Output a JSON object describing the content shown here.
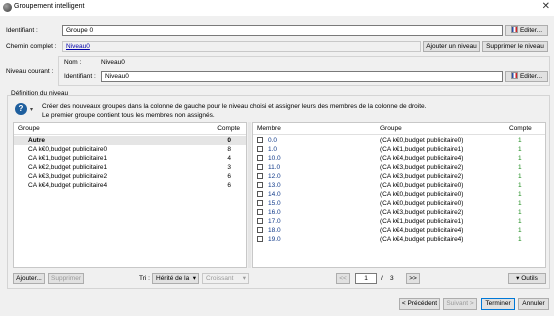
{
  "window": {
    "title": "Groupement intelligent",
    "close": "✕"
  },
  "form": {
    "identifiant_label": "Identifiant :",
    "identifiant_value": "Groupe 0",
    "edit_label": "Editer...",
    "chemin_label": "Chemin complet :",
    "chemin_value": "Niveau0",
    "add_level": "Ajouter un niveau",
    "remove_level": "Supprimer le niveau",
    "niveau_courant_label": "Niveau courant :",
    "nom_label": "Nom :",
    "nom_value": "Niveau0",
    "identifiant2_label": "Identifiant :",
    "identifiant2_value": "Niveau0",
    "definition_label": "Définition du niveau",
    "info_line1": "Créer des nouveaux groupes dans la colonne de gauche pour le niveau choisi et assigner leurs des membres de la colonne de droite.",
    "info_line2": "Le premier groupe contient tous les membres non assignés."
  },
  "left_table": {
    "col_group": "Groupe",
    "col_count": "Compte",
    "rows": [
      {
        "name": "Autre",
        "count": "0"
      },
      {
        "name": "CA k€0,budget publicitaire0",
        "count": "8"
      },
      {
        "name": "CA k€1,budget publicitaire1",
        "count": "4"
      },
      {
        "name": "CA k€2,budget publicitaire1",
        "count": "3"
      },
      {
        "name": "CA k€3,budget publicitaire2",
        "count": "6"
      },
      {
        "name": "CA k€4,budget publicitaire4",
        "count": "6"
      }
    ]
  },
  "right_table": {
    "col_member": "Membre",
    "col_group": "Groupe",
    "col_count": "Compte",
    "rows": [
      {
        "member": "0.0",
        "group": "(CA k€0,budget publicitaire0)",
        "count": "1"
      },
      {
        "member": "1.0",
        "group": "(CA k€1,budget publicitaire1)",
        "count": "1"
      },
      {
        "member": "10.0",
        "group": "(CA k€4,budget publicitaire4)",
        "count": "1"
      },
      {
        "member": "11.0",
        "group": "(CA k€3,budget publicitaire2)",
        "count": "1"
      },
      {
        "member": "12.0",
        "group": "(CA k€3,budget publicitaire2)",
        "count": "1"
      },
      {
        "member": "13.0",
        "group": "(CA k€0,budget publicitaire0)",
        "count": "1"
      },
      {
        "member": "14.0",
        "group": "(CA k€0,budget publicitaire0)",
        "count": "1"
      },
      {
        "member": "15.0",
        "group": "(CA k€0,budget publicitaire0)",
        "count": "1"
      },
      {
        "member": "16.0",
        "group": "(CA k€3,budget publicitaire2)",
        "count": "1"
      },
      {
        "member": "17.0",
        "group": "(CA k€1,budget publicitaire1)",
        "count": "1"
      },
      {
        "member": "18.0",
        "group": "(CA k€4,budget publicitaire4)",
        "count": "1"
      },
      {
        "member": "19.0",
        "group": "(CA k€4,budget publicitaire4)",
        "count": "1"
      }
    ]
  },
  "bottom": {
    "add": "Ajouter...",
    "remove": "Supprimer",
    "tri_label": "Tri :",
    "tri_value": "Hérité de la",
    "order_value": "Croissant",
    "first": "<<",
    "page": "1",
    "of": "/",
    "total": "3",
    "next": ">>",
    "tools": "Outils"
  },
  "footer": {
    "prev": "< Précédent",
    "next": "Suivant >",
    "finish": "Terminer",
    "cancel": "Annuler"
  }
}
